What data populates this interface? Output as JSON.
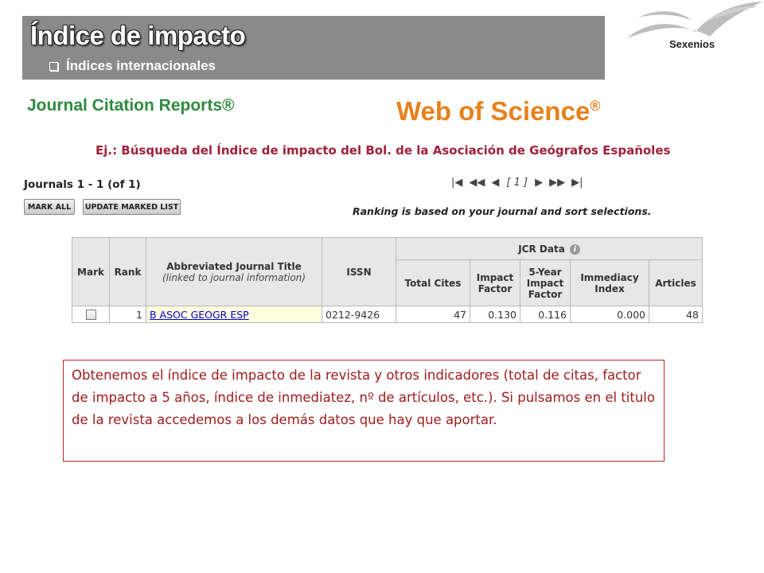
{
  "header": {
    "title": "Índice de impacto",
    "subtitle": "Índices internacionales",
    "logo_label": "Sexenios"
  },
  "logos": {
    "jcr": "Journal Citation Reports®",
    "wos": "Web of Science",
    "wos_mark": "®"
  },
  "example_caption": "Ej.: Búsqueda del Índice de impacto del Bol. de la Asociación de Geógrafos Españoles",
  "results": {
    "count_label": "Journals 1 - 1 (of 1)",
    "buttons": {
      "mark_all": "MARK ALL",
      "update_marked": "UPDATE MARKED LIST"
    },
    "pager": {
      "first": "|◀",
      "prev_fast": "◀◀",
      "prev": "◀",
      "page": "[ 1 ]",
      "next": "▶",
      "next_fast": "▶▶",
      "last": "▶|"
    },
    "ranking_note": "Ranking is based on your journal and sort selections."
  },
  "table": {
    "group_header": "JCR Data",
    "columns": {
      "mark": "Mark",
      "rank": "Rank",
      "title": "Abbreviated Journal Title",
      "title_note": "(linked to journal information)",
      "issn": "ISSN",
      "total_cites": "Total Cites",
      "impact_factor": "Impact Factor",
      "five_year": "5-Year Impact Factor",
      "immediacy": "Immediacy Index",
      "articles": "Articles"
    },
    "rows": [
      {
        "rank": "1",
        "title": "B ASOC GEOGR ESP",
        "issn": "0212-9426",
        "total_cites": "47",
        "impact_factor": "0.130",
        "five_year": "0.116",
        "immediacy": "0.000",
        "articles": "48"
      }
    ]
  },
  "note": "Obtenemos el índice de impacto de la revista y otros indicadores (total de citas, factor de impacto a 5 años, índice de inmediatez, nº de artículos, etc.). Si pulsamos en el titulo de la revista accedemos a los demás datos que hay que aportar.",
  "colors": {
    "header_bg": "#8a8a8a",
    "jcr_green": "#2e8b3e",
    "wos_orange": "#e8811c",
    "caption_red": "#a0203a",
    "note_red": "#a01c1c",
    "link_blue": "#0000cc"
  }
}
